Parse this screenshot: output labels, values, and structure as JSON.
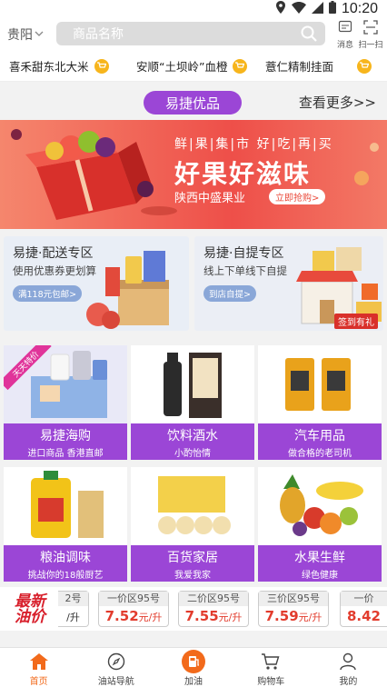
{
  "status_bar": {
    "time": "10:20"
  },
  "header": {
    "city": "贵阳",
    "search_placeholder": "商品名称",
    "message_label": "消息",
    "scan_label": "扫一扫"
  },
  "product_strip": [
    {
      "name": "喜禾甜东北大米"
    },
    {
      "name": "安顺“土坝岭”血橙"
    },
    {
      "name": "薏仁精制挂面"
    }
  ],
  "section": {
    "title": "易捷优品",
    "more": "查看更多>>"
  },
  "banner": {
    "line1": "鲜|果|集|市  好|吃|再|买",
    "line2": "好果好滋味",
    "line3": "陕西中盛果业",
    "button": "立即抢购>",
    "accent": "#ee4f49"
  },
  "zones": [
    {
      "title": "易捷·配送专区",
      "subtitle": "使用优惠券更划算",
      "tag": "满118元包邮>"
    },
    {
      "title": "易捷·自提专区",
      "subtitle": "线上下单线下自提",
      "tag": "到店自提>",
      "badge": "签到有礼"
    }
  ],
  "categories": [
    {
      "title": "易捷海购",
      "subtitle": "进口商品 香港直邮",
      "ribbon": "天天特价"
    },
    {
      "title": "饮料酒水",
      "subtitle": "小酌怡情"
    },
    {
      "title": "汽车用品",
      "subtitle": "做合格的老司机"
    },
    {
      "title": "粮油调味",
      "subtitle": "挑战你的18般厨艺"
    },
    {
      "title": "百货家居",
      "subtitle": "我爱我家"
    },
    {
      "title": "水果生鲜",
      "subtitle": "绿色健康"
    }
  ],
  "oil_prices": {
    "logo_line1": "最新",
    "logo_line2": "油价",
    "cards": [
      {
        "header": "2号",
        "value": "",
        "unit": "/升"
      },
      {
        "header": "一价区95号",
        "value": "7.52",
        "unit": "元/升"
      },
      {
        "header": "二价区95号",
        "value": "7.55",
        "unit": "元/升"
      },
      {
        "header": "三价区95号",
        "value": "7.59",
        "unit": "元/升"
      },
      {
        "header": "一价",
        "value": "8.42",
        "unit": ""
      }
    ]
  },
  "tabbar": [
    {
      "label": "首页",
      "icon": "home-icon",
      "active": true
    },
    {
      "label": "油站导航",
      "icon": "compass-icon"
    },
    {
      "label": "加油",
      "icon": "fuel-icon"
    },
    {
      "label": "购物车",
      "icon": "cart-icon"
    },
    {
      "label": "我的",
      "icon": "user-icon"
    }
  ],
  "colors": {
    "brand_purple": "#9b46d6",
    "accent_orange": "#f26a1b",
    "price_red": "#e23c2d"
  }
}
